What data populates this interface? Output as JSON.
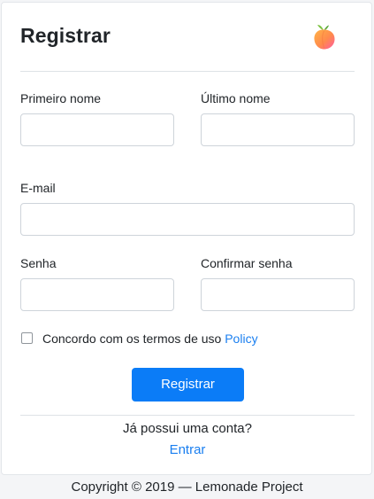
{
  "form": {
    "title": "Registrar",
    "logo_icon": "peach-icon",
    "first_name_label": "Primeiro nome",
    "last_name_label": "Último nome",
    "email_label": "E-mail",
    "password_label": "Senha",
    "confirm_password_label": "Confirmar senha",
    "first_name_value": "",
    "last_name_value": "",
    "email_value": "",
    "password_value": "",
    "confirm_password_value": "",
    "terms_text": "Concordo com os termos de uso",
    "terms_link": "Policy",
    "submit_label": "Registrar",
    "has_account_text": "Já possui uma conta?",
    "login_link": "Entrar"
  },
  "footer": {
    "text": "Copyright © 2019 — Lemonade Project"
  },
  "colors": {
    "accent": "#0b7cf7",
    "link": "#1a7ff0",
    "border": "#ced4da"
  }
}
